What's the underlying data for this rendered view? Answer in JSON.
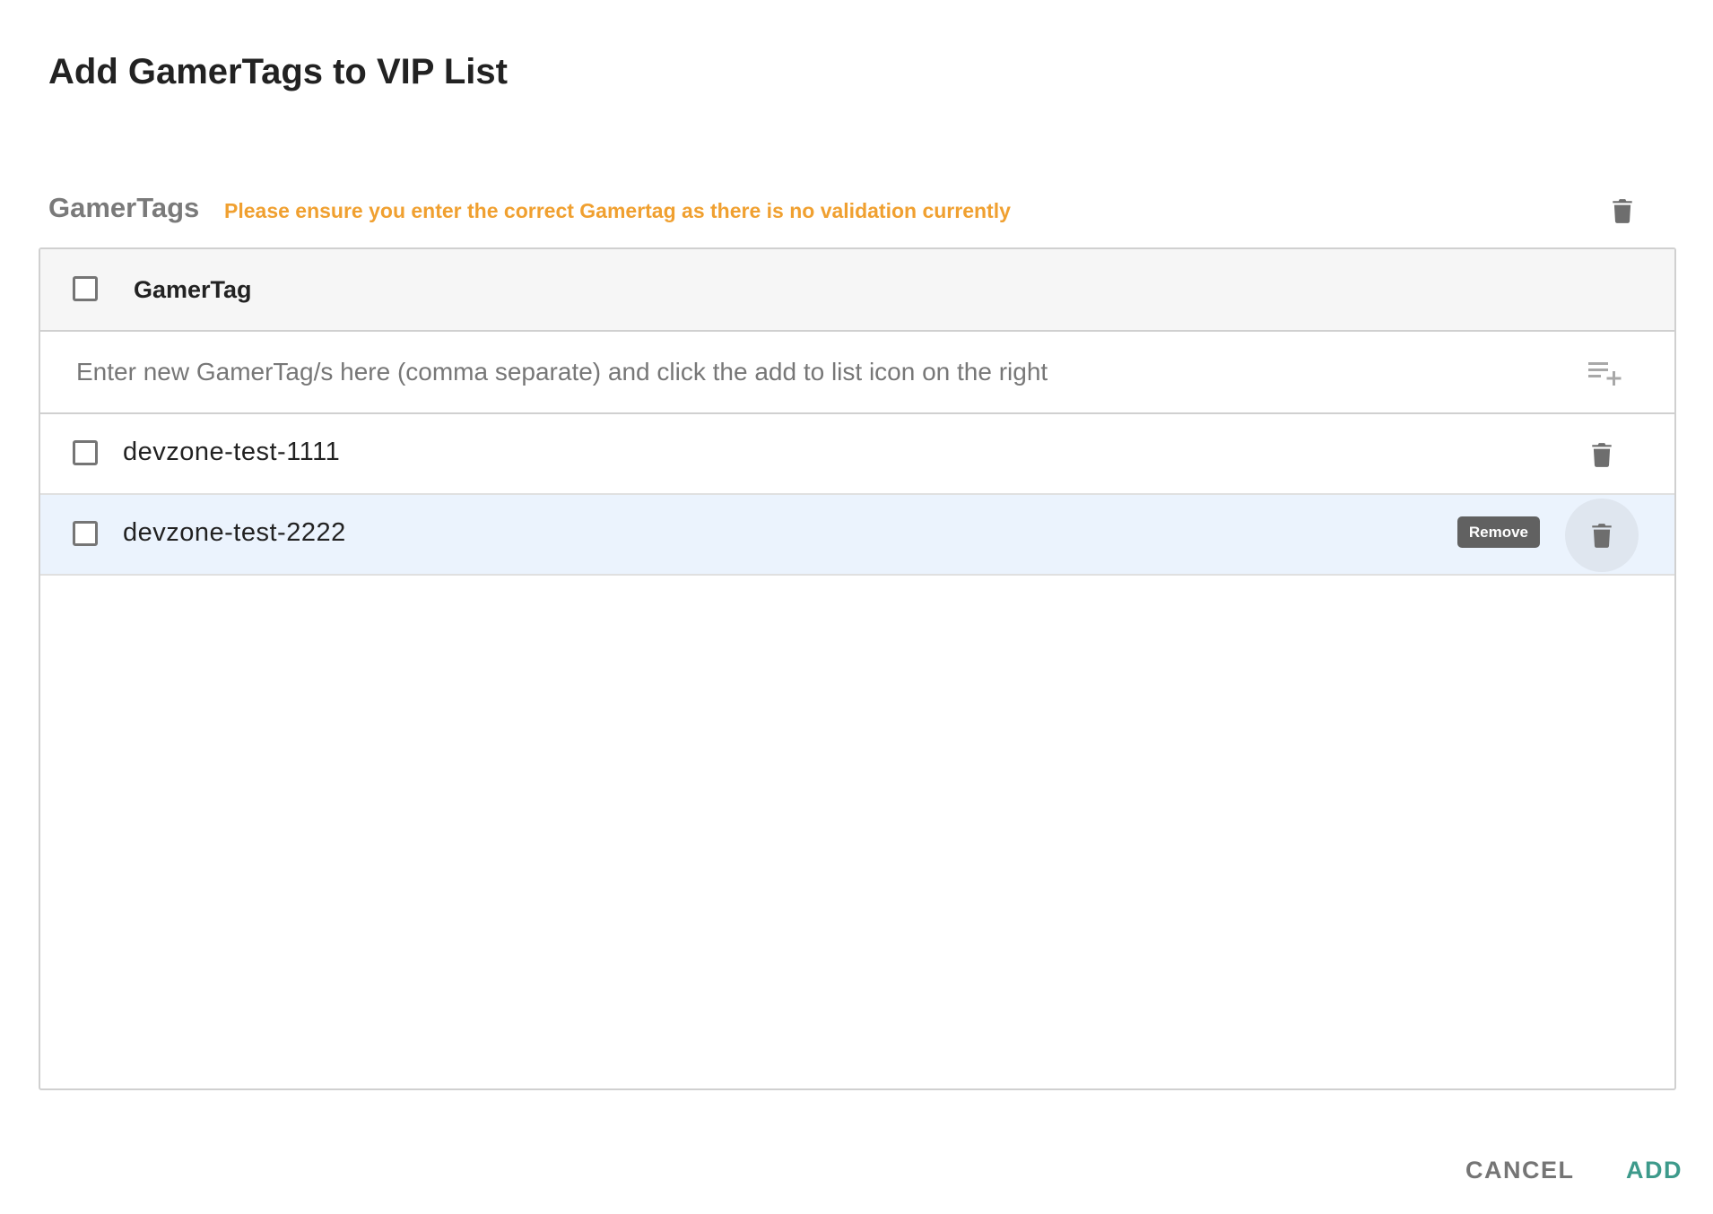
{
  "dialog": {
    "title": "Add GamerTags to VIP List"
  },
  "section": {
    "label": "GamerTags",
    "warning": "Please ensure you enter the correct Gamertag as there is no validation currently",
    "warning_color": "#f0a030"
  },
  "table": {
    "column_header": "GamerTag",
    "input_placeholder": "Enter new GamerTag/s here (comma separate) and click the add to list icon on the right",
    "input_value": "",
    "rows": [
      {
        "gamertag": "devzone-test-1111",
        "checked": false
      },
      {
        "gamertag": "devzone-test-2222",
        "checked": false,
        "hovered": true
      }
    ],
    "tooltip": "Remove"
  },
  "icons": {
    "delete": "trash-icon",
    "add_to_list": "playlist-add-icon"
  },
  "footer": {
    "cancel_label": "CANCEL",
    "add_label": "ADD",
    "add_color": "#3d9a8b"
  }
}
